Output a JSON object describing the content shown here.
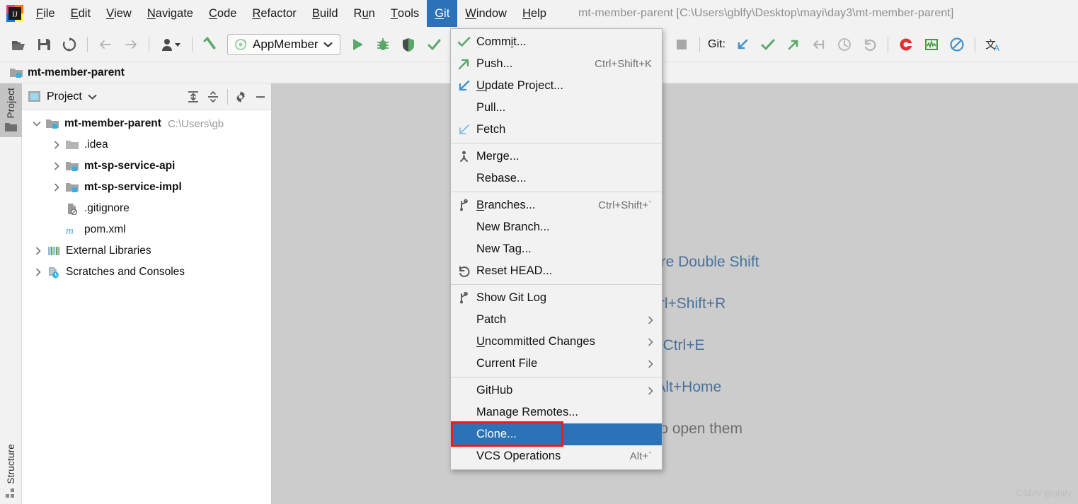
{
  "window": {
    "title": "mt-member-parent [C:\\Users\\gblfy\\Desktop\\mayi\\day3\\mt-member-parent]",
    "app_icon": "intellij-idea-logo"
  },
  "menubar": {
    "items": [
      {
        "label": "File",
        "mnemonic": "F",
        "active": false
      },
      {
        "label": "Edit",
        "mnemonic": "E",
        "active": false
      },
      {
        "label": "View",
        "mnemonic": "V",
        "active": false
      },
      {
        "label": "Navigate",
        "mnemonic": "N",
        "active": false
      },
      {
        "label": "Code",
        "mnemonic": "C",
        "active": false
      },
      {
        "label": "Refactor",
        "mnemonic": "R",
        "active": false
      },
      {
        "label": "Build",
        "mnemonic": "B",
        "active": false
      },
      {
        "label": "Run",
        "mnemonic": "u",
        "active": false
      },
      {
        "label": "Tools",
        "mnemonic": "T",
        "active": false
      },
      {
        "label": "Git",
        "mnemonic": "G",
        "active": true
      },
      {
        "label": "Window",
        "mnemonic": "W",
        "active": false
      },
      {
        "label": "Help",
        "mnemonic": "H",
        "active": false
      }
    ]
  },
  "toolbar": {
    "left_buttons": [
      {
        "name": "open-folder-icon",
        "tooltip": "Open"
      },
      {
        "name": "save-all-icon",
        "tooltip": "Save All"
      },
      {
        "name": "sync-refresh-icon",
        "tooltip": "Synchronize"
      }
    ],
    "nav_buttons": [
      {
        "name": "back-arrow-icon",
        "tooltip": "Back"
      },
      {
        "name": "forward-arrow-icon",
        "tooltip": "Forward"
      }
    ],
    "profile_button": {
      "name": "user-profile-icon",
      "tooltip": "Profile"
    },
    "build_button": {
      "name": "build-hammer-icon",
      "tooltip": "Build Project"
    },
    "run_config": {
      "label": "AppMember",
      "icon": "spring-boot-icon",
      "chevron": "chevron-down-icon"
    },
    "run_buttons": [
      {
        "name": "run-icon",
        "tooltip": "Run"
      },
      {
        "name": "debug-icon",
        "tooltip": "Debug"
      },
      {
        "name": "coverage-icon",
        "tooltip": "Run with Coverage"
      },
      {
        "name": "inspect-icon",
        "tooltip": "Inspect"
      }
    ],
    "stop_button": {
      "name": "stop-icon",
      "tooltip": "Stop"
    },
    "git_label": "Git:",
    "git_buttons": [
      {
        "name": "update-project-icon",
        "tooltip": "Update Project"
      },
      {
        "name": "commit-icon",
        "tooltip": "Commit"
      },
      {
        "name": "push-icon",
        "tooltip": "Push"
      },
      {
        "name": "rollback-icon",
        "tooltip": "Rollback"
      },
      {
        "name": "history-clock-icon",
        "tooltip": "Show History"
      },
      {
        "name": "revert-icon",
        "tooltip": "Revert"
      }
    ],
    "plugin_buttons": [
      {
        "name": "codota-icon",
        "tooltip": "Codota"
      },
      {
        "name": "monitor-chart-icon",
        "tooltip": "Monitor"
      },
      {
        "name": "disable-icon",
        "tooltip": "Disable"
      },
      {
        "name": "translate-icon",
        "tooltip": "Translate"
      }
    ]
  },
  "breadcrumb": {
    "label": "mt-member-parent",
    "icon": "module-folder-icon"
  },
  "tool_stripes": {
    "left_top": {
      "label": "Project",
      "selected": true,
      "icon": "folder-icon"
    },
    "left_bottom": {
      "label": "Structure",
      "selected": false,
      "icon": "structure-icon"
    }
  },
  "project_panel": {
    "combo_label": "Project",
    "combo_icon": "project-view-icon",
    "chevron": "chevron-down-icon",
    "buttons": [
      {
        "name": "expand-all-icon",
        "tooltip": "Expand All"
      },
      {
        "name": "collapse-all-icon",
        "tooltip": "Collapse All"
      },
      {
        "name": "gear-icon",
        "tooltip": "Settings"
      },
      {
        "name": "minimize-icon",
        "tooltip": "Hide"
      }
    ],
    "tree": [
      {
        "label": "mt-member-parent",
        "path": "C:\\Users\\gb",
        "indent": 0,
        "twisty": "expanded",
        "icon": "module-folder-icon",
        "bold": true
      },
      {
        "label": ".idea",
        "path": "",
        "indent": 1,
        "twisty": "collapsed",
        "icon": "plain-folder-icon",
        "bold": false
      },
      {
        "label": "mt-sp-service-api",
        "path": "",
        "indent": 1,
        "twisty": "collapsed",
        "icon": "module-folder-icon",
        "bold": true
      },
      {
        "label": "mt-sp-service-impl",
        "path": "",
        "indent": 1,
        "twisty": "collapsed",
        "icon": "module-folder-icon",
        "bold": true
      },
      {
        "label": ".gitignore",
        "path": "",
        "indent": 1,
        "twisty": "none",
        "icon": "gitignore-file-icon",
        "bold": false
      },
      {
        "label": "pom.xml",
        "path": "",
        "indent": 1,
        "twisty": "none",
        "icon": "maven-file-icon",
        "bold": false
      },
      {
        "label": "External Libraries",
        "path": "",
        "indent": 0,
        "twisty": "collapsed",
        "icon": "libraries-icon",
        "bold": false
      },
      {
        "label": "Scratches and Consoles",
        "path": "",
        "indent": 0,
        "twisty": "collapsed",
        "icon": "scratches-icon",
        "bold": false
      }
    ]
  },
  "editor": {
    "tips": [
      "Search Everywhere Double Shift",
      "Go to File Ctrl+Shift+R",
      "Recent Files Ctrl+E",
      "Navigation Bar Alt+Home",
      "Drop files here to open them"
    ],
    "watermark": "CSDN @gblfy"
  },
  "git_menu": {
    "sections": [
      {
        "items": [
          {
            "label": "Commit...",
            "mnemonic": "i",
            "shortcut": "",
            "icon": "commit-check-icon",
            "submenu": false,
            "selected": false
          },
          {
            "label": "Push...",
            "mnemonic": "",
            "shortcut": "Ctrl+Shift+K",
            "icon": "push-arrow-icon",
            "submenu": false,
            "selected": false
          },
          {
            "label": "Update Project...",
            "mnemonic": "U",
            "shortcut": "",
            "icon": "update-arrow-icon",
            "submenu": false,
            "selected": false
          },
          {
            "label": "Pull...",
            "mnemonic": "",
            "shortcut": "",
            "icon": "",
            "submenu": false,
            "selected": false
          },
          {
            "label": "Fetch",
            "mnemonic": "",
            "shortcut": "",
            "icon": "fetch-arrow-icon",
            "submenu": false,
            "selected": false
          }
        ]
      },
      {
        "items": [
          {
            "label": "Merge...",
            "mnemonic": "",
            "shortcut": "",
            "icon": "merge-icon",
            "submenu": false,
            "selected": false
          },
          {
            "label": "Rebase...",
            "mnemonic": "",
            "shortcut": "",
            "icon": "",
            "submenu": false,
            "selected": false
          }
        ]
      },
      {
        "items": [
          {
            "label": "Branches...",
            "mnemonic": "B",
            "shortcut": "Ctrl+Shift+`",
            "icon": "branch-icon",
            "submenu": false,
            "selected": false
          },
          {
            "label": "New Branch...",
            "mnemonic": "",
            "shortcut": "",
            "icon": "",
            "submenu": false,
            "selected": false
          },
          {
            "label": "New Tag...",
            "mnemonic": "",
            "shortcut": "",
            "icon": "",
            "submenu": false,
            "selected": false
          },
          {
            "label": "Reset HEAD...",
            "mnemonic": "",
            "shortcut": "",
            "icon": "reset-head-icon",
            "submenu": false,
            "selected": false
          }
        ]
      },
      {
        "items": [
          {
            "label": "Show Git Log",
            "mnemonic": "",
            "shortcut": "",
            "icon": "branch-icon",
            "submenu": false,
            "selected": false
          },
          {
            "label": "Patch",
            "mnemonic": "",
            "shortcut": "",
            "icon": "",
            "submenu": true,
            "selected": false
          },
          {
            "label": "Uncommitted Changes",
            "mnemonic": "U",
            "shortcut": "",
            "icon": "",
            "submenu": true,
            "selected": false
          },
          {
            "label": "Current File",
            "mnemonic": "",
            "shortcut": "",
            "icon": "",
            "submenu": true,
            "selected": false
          }
        ]
      },
      {
        "items": [
          {
            "label": "GitHub",
            "mnemonic": "",
            "shortcut": "",
            "icon": "",
            "submenu": true,
            "selected": false
          },
          {
            "label": "Manage Remotes...",
            "mnemonic": "",
            "shortcut": "",
            "icon": "",
            "submenu": false,
            "selected": false
          },
          {
            "label": "Clone...",
            "mnemonic": "",
            "shortcut": "",
            "icon": "",
            "submenu": false,
            "selected": true
          },
          {
            "label": "VCS Operations",
            "mnemonic": "",
            "shortcut": "Alt+`",
            "icon": "",
            "submenu": false,
            "selected": false
          }
        ]
      }
    ]
  },
  "annotation": {
    "shape": "rectangle",
    "color": "#ef1c1c",
    "target": "Clone..."
  },
  "colors": {
    "accent_blue": "#2c72b8",
    "editor_bg": "#cccccc",
    "panel_bg": "#f2f2f2",
    "tree_bg": "#ffffff",
    "annotation_red": "#ef1c1c",
    "tip_text": "#4a719e"
  }
}
